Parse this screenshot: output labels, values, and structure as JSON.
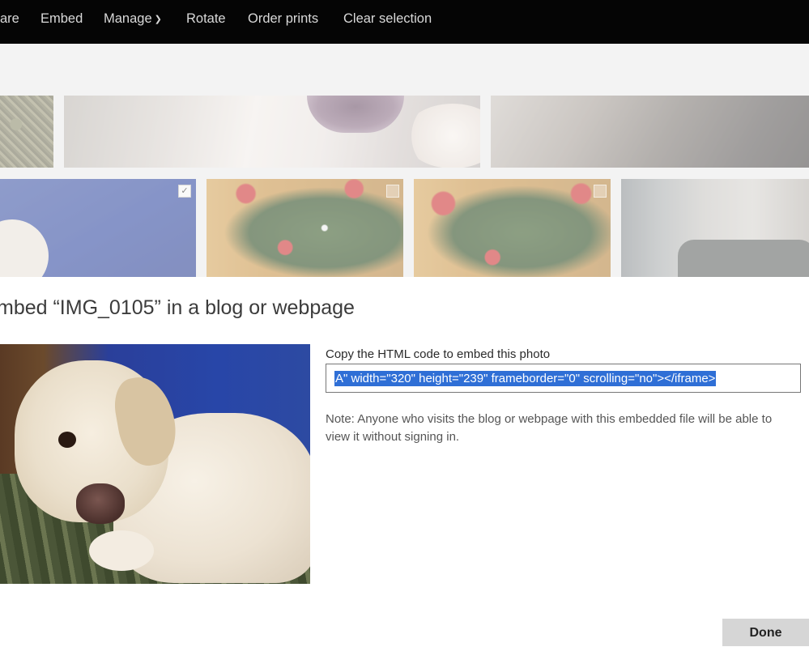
{
  "toolbar": {
    "items": [
      {
        "label": "are"
      },
      {
        "label": "Embed"
      },
      {
        "label": "Manage"
      },
      {
        "label": "Rotate"
      },
      {
        "label": "Order prints"
      },
      {
        "label": "Clear selection"
      }
    ]
  },
  "gallery": {
    "selected_checkmark": "✓"
  },
  "dialog": {
    "title": "mbed “IMG_0105” in a blog or webpage",
    "copy_label": "Copy the HTML code to embed this photo",
    "code_value": "A\" width=\"320\" height=\"239\" frameborder=\"0\" scrolling=\"no\"></iframe>",
    "note": "Note: Anyone who visits the blog or webpage with this embedded file will be able to view it without signing in.",
    "done_label": "Done"
  },
  "icons": {
    "manage_dropdown": "chevron-down-icon",
    "tile_selected": "checkbox-checked-icon"
  },
  "colors": {
    "topbar": "#050505",
    "selection": "#2f6fd6",
    "done_button": "#d6d6d6"
  }
}
